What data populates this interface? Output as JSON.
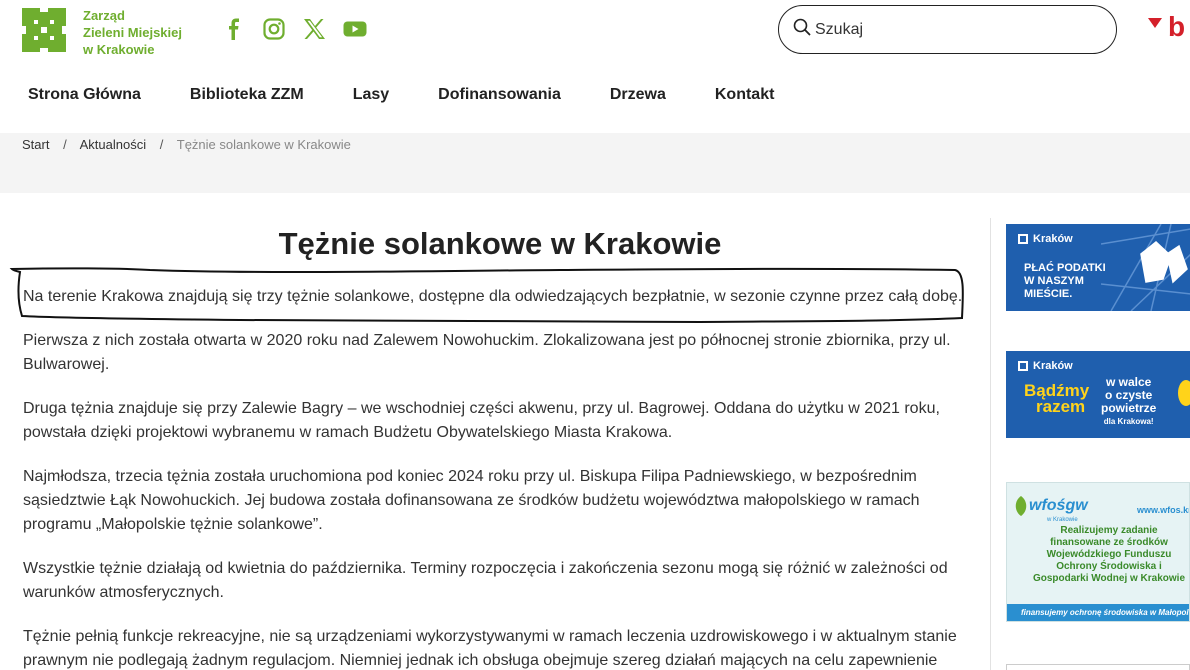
{
  "header": {
    "logo_lines": [
      "Zarząd",
      "Zieleni Miejskiej",
      "w Krakowie"
    ],
    "social_icons": [
      "facebook-icon",
      "instagram-icon",
      "x-icon",
      "youtube-icon"
    ],
    "search_placeholder": "Szukaj",
    "bip_label": "b"
  },
  "nav": {
    "items": [
      "Strona Główna",
      "Biblioteka ZZM",
      "Lasy",
      "Dofinansowania",
      "Drzewa",
      "Kontakt"
    ]
  },
  "breadcrumb": {
    "items": [
      "Start",
      "Aktualności"
    ],
    "current": "Tężnie solankowe w Krakowie",
    "separator": "/"
  },
  "article": {
    "title": "Tężnie solankowe w Krakowie",
    "paragraphs": [
      "Na terenie Krakowa znajdują się trzy tężnie solankowe, dostępne dla odwiedzających bezpłatnie, w sezonie czynne przez całą dobę.",
      "Pierwsza z nich została otwarta w 2020 roku nad Zalewem Nowohuckim. Zlokalizowana jest po północnej stronie zbiornika, przy ul. Bulwarowej.",
      "Druga tężnia znajduje się przy Zalewie Bagry – we wschodniej części akwenu, przy ul. Bagrowej. Oddana do użytku w 2021 roku, powstała dzięki projektowi wybranemu w ramach Budżetu Obywatelskiego Miasta Krakowa.",
      "Najmłodsza, trzecia tężnia została uruchomiona pod koniec 2024 roku przy ul. Biskupa Filipa Padniewskiego, w bezpośrednim sąsiedztwie Łąk Nowohuckich. Jej budowa została dofinansowana ze środków budżetu województwa małopolskiego w ramach programu „Małopolskie tężnie solankowe”.",
      "Wszystkie tężnie działają od kwietnia do października. Terminy rozpoczęcia i zakończenia sezonu mogą się różnić w zależności od warunków atmosferycznych.",
      "Tężnie pełnią funkcje rekreacyjne, nie są urządzeniami wykorzystywanymi w ramach leczenia uzdrowiskowego i w aktualnym stanie prawnym nie podlegają żadnym regulacjom. Niemniej jednak ich obsługa obejmuje szereg działań mających na celu zapewnienie"
    ]
  },
  "sidebar": {
    "banner1": {
      "brand": "Kraków",
      "text": "PŁAĆ PODATKI W NASZYM MIEŚCIE."
    },
    "banner2": {
      "brand": "Kraków",
      "left_line1": "Bądźmy",
      "left_line2": "razem",
      "right_line1": "w walce",
      "right_line2": "o czyste",
      "right_line3": "powietrze",
      "right_small": "dla Krakowa!"
    },
    "banner3": {
      "logo": "wfośgw",
      "logo_sub": "w Krakowie",
      "url": "www.wfos.krakow.pl",
      "text": "Realizujemy zadanie finansowane ze środków Wojewódzkiego Funduszu Ochrony Środowiska i Gospodarki Wodnej w Krakowie",
      "footer": "finansujemy ochronę środowiska w Małopolsce"
    }
  },
  "colors": {
    "brand_green": "#6fae2f",
    "bip_red": "#d4202a",
    "banner_blue": "#1f5fae",
    "highlight_yellow": "#ffd31a"
  }
}
